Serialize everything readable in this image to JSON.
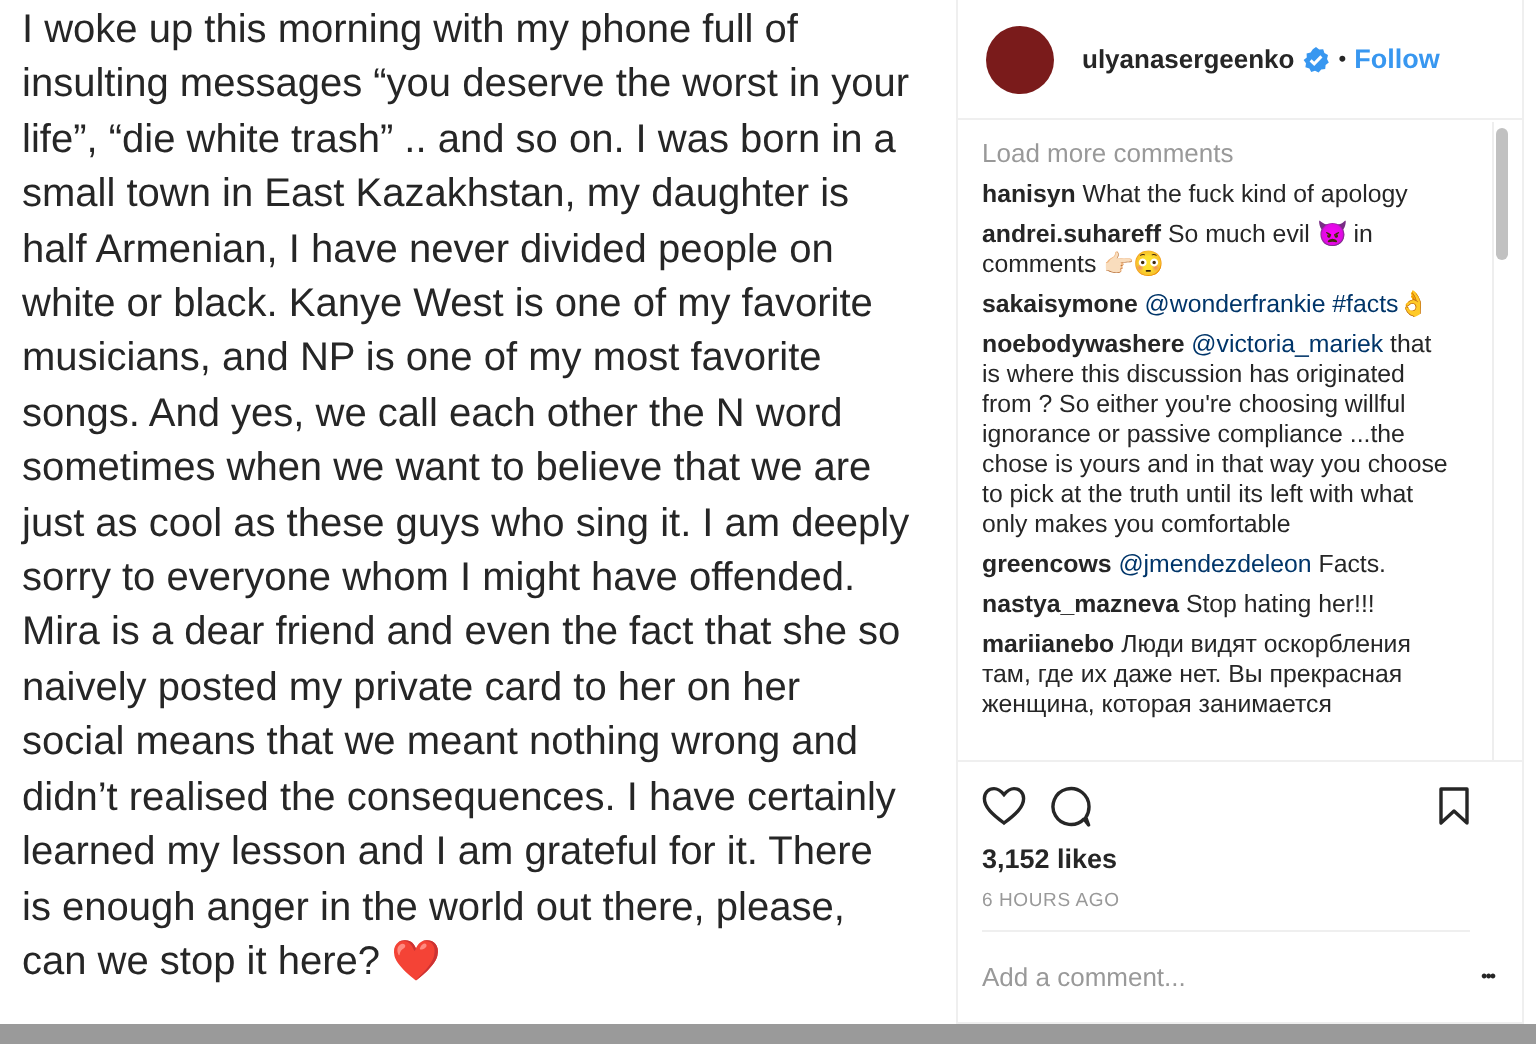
{
  "post_text": {
    "lines": [
      "I woke up this morning with my phone full of",
      "insulting messages “you deserve the worst in your",
      "life”, “die white trash” .. and so on. I was born in a",
      "small town in East Kazakhstan, my daughter is",
      "half Armenian, I have never divided people on",
      "white or black. Kanye West is one of my favorite",
      "musicians, and NP is one of my most favorite",
      "songs. And yes, we call each other the N word",
      "sometimes when we want to believe that we are",
      "just as cool as these guys who sing it. I am deeply",
      "sorry to everyone whom I might have offended.",
      "Mira is a dear friend and even the fact that she so",
      "naively posted my private card to her on her",
      "social means that we meant nothing wrong and",
      "didn’t realised the consequences. I have certainly",
      "learned my lesson and I am grateful for it. There",
      "is enough anger in the world out there, please,",
      "can we stop it here? ❤️"
    ]
  },
  "header": {
    "username": "ulyanasergeenko",
    "separator": "•",
    "follow": "Follow"
  },
  "comments": {
    "load_more": "Load more comments",
    "items": [
      {
        "user": "hanisyn",
        "text": "What the fuck kind of apology"
      },
      {
        "user": "andrei.suhareff",
        "text": "So much evil 👿 in comments 👉🏻😳"
      },
      {
        "user": "sakaisymone",
        "mention": "@wonderfrankie #facts👌"
      },
      {
        "user": "noebodywashere",
        "mention": "@victoria_mariek",
        "text": "that is where this discussion has originated from ? So either you're choosing willful ignorance or passive compliance ...the chose is yours and in that way you choose to pick at the truth until its left with what only makes you comfortable"
      },
      {
        "user": "greencows",
        "mention": "@jmendezdeleon",
        "text": "Facts."
      },
      {
        "user": "nastya_mazneva",
        "text": "Stop hating her!!!"
      },
      {
        "user": "mariianebo",
        "text": "Люди видят оскорбления там, где их даже нет. Вы прекрасная женщина, которая занимается"
      }
    ]
  },
  "likes": "3,152 likes",
  "time": "6 HOURS AGO",
  "add_comment": {
    "placeholder": "Add a comment..."
  },
  "more": "•••"
}
